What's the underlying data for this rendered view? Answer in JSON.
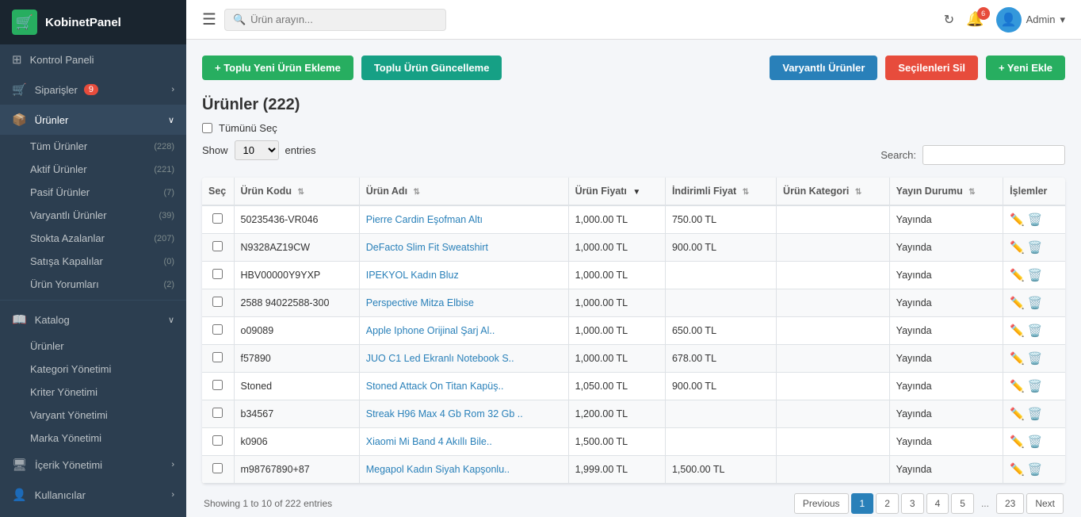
{
  "brand": {
    "name": "KobinetPanel",
    "icon": "🛒"
  },
  "sidebar": {
    "items": [
      {
        "id": "kontrol-paneli",
        "label": "Kontrol Paneli",
        "icon": "⊞",
        "badge": null,
        "hasArrow": false
      },
      {
        "id": "siparisler",
        "label": "Siparişler",
        "icon": "🛒",
        "badge": "9",
        "hasArrow": true
      },
      {
        "id": "urunler",
        "label": "Ürünler",
        "icon": "📦",
        "badge": null,
        "hasArrow": true,
        "active": true
      }
    ],
    "urunler_sub": [
      {
        "id": "tum-urunler",
        "label": "Tüm Ürünler",
        "count": "(228)"
      },
      {
        "id": "aktif-urunler",
        "label": "Aktif Ürünler",
        "count": "(221)"
      },
      {
        "id": "pasif-urunler",
        "label": "Pasif Ürünler",
        "count": "(7)"
      },
      {
        "id": "varyantli-urunler",
        "label": "Varyantlı Ürünler",
        "count": "(39)"
      },
      {
        "id": "stokta-azalanlar",
        "label": "Stokta Azalanlar",
        "count": "(207)"
      },
      {
        "id": "satisa-kapalanlar",
        "label": "Satışa Kapalılar",
        "count": "(0)"
      },
      {
        "id": "urun-yorumlari",
        "label": "Ürün Yorumları",
        "count": "(2)"
      }
    ],
    "katalog": {
      "label": "Katalog",
      "sub": [
        {
          "id": "katalog-urunler",
          "label": "Ürünler"
        },
        {
          "id": "kategori-yonetimi",
          "label": "Kategori Yönetimi"
        },
        {
          "id": "kriter-yonetimi",
          "label": "Kriter Yönetimi"
        },
        {
          "id": "varyant-yonetimi",
          "label": "Varyant Yönetimi"
        },
        {
          "id": "marka-yonetimi",
          "label": "Marka Yönetimi"
        }
      ]
    },
    "icerik": {
      "label": "İçerik Yönetimi",
      "hasArrow": true
    },
    "kullanicilar": {
      "label": "Kullanıcılar",
      "hasArrow": true
    }
  },
  "topbar": {
    "search_placeholder": "Ürün arayın...",
    "bell_count": "6",
    "user_label": "Admin"
  },
  "buttons": {
    "bulk_add": "+ Toplu Yeni Ürün Ekleme",
    "bulk_update": "Toplu Ürün Güncelleme",
    "variant_products": "Varyantlı Ürünler",
    "delete_selected": "Seçilenleri Sil",
    "new_add": "+ Yeni Ekle"
  },
  "page": {
    "title": "Ürünler (222)",
    "select_all": "Tümünü Seç",
    "show_label": "Show",
    "entries_label": "entries",
    "show_count": "10",
    "search_label": "Search:"
  },
  "table": {
    "columns": [
      {
        "id": "sec",
        "label": "Seç",
        "sortable": false
      },
      {
        "id": "urun-kodu",
        "label": "Ürün Kodu",
        "sortable": true
      },
      {
        "id": "urun-adi",
        "label": "Ürün Adı",
        "sortable": true
      },
      {
        "id": "urun-fiyati",
        "label": "Ürün Fiyatı",
        "sortable": true,
        "active": true,
        "dir": "asc"
      },
      {
        "id": "indirimli-fiyat",
        "label": "İndirimli Fiyat",
        "sortable": true
      },
      {
        "id": "urun-kategori",
        "label": "Ürün Kategori",
        "sortable": true
      },
      {
        "id": "yayin-durumu",
        "label": "Yayın Durumu",
        "sortable": true
      },
      {
        "id": "islemler",
        "label": "İşlemler",
        "sortable": false
      }
    ],
    "rows": [
      {
        "id": 1,
        "kod": "50235436-VR046",
        "adi": "Pierre Cardin Eşofman Altı",
        "fiyat": "1,000.00 TL",
        "indirimli": "750.00 TL",
        "kategori": "",
        "durum": "Yayında"
      },
      {
        "id": 2,
        "kod": "N9328AZ19CW",
        "adi": "DeFacto Slim Fit Sweatshirt",
        "fiyat": "1,000.00 TL",
        "indirimli": "900.00 TL",
        "kategori": "",
        "durum": "Yayında"
      },
      {
        "id": 3,
        "kod": "HBV00000Y9YXP",
        "adi": "IPEKYOL Kadın Bluz",
        "fiyat": "1,000.00 TL",
        "indirimli": "",
        "kategori": "",
        "durum": "Yayında"
      },
      {
        "id": 4,
        "kod": "2588 94022588-300",
        "adi": "Perspective Mitza Elbise",
        "fiyat": "1,000.00 TL",
        "indirimli": "",
        "kategori": "",
        "durum": "Yayında"
      },
      {
        "id": 5,
        "kod": "o09089",
        "adi": "Apple Iphone Orijinal Şarj Al..",
        "fiyat": "1,000.00 TL",
        "indirimli": "650.00 TL",
        "kategori": "",
        "durum": "Yayında"
      },
      {
        "id": 6,
        "kod": "f57890",
        "adi": "JUO C1 Led Ekranlı Notebook S..",
        "fiyat": "1,000.00 TL",
        "indirimli": "678.00 TL",
        "kategori": "",
        "durum": "Yayında"
      },
      {
        "id": 7,
        "kod": "Stoned",
        "adi": "Stoned Attack On Titan Kapüş..",
        "fiyat": "1,050.00 TL",
        "indirimli": "900.00 TL",
        "kategori": "",
        "durum": "Yayında"
      },
      {
        "id": 8,
        "kod": "b34567",
        "adi": "Streak H96 Max 4 Gb Rom 32 Gb ..",
        "fiyat": "1,200.00 TL",
        "indirimli": "",
        "kategori": "",
        "durum": "Yayında"
      },
      {
        "id": 9,
        "kod": "k0906",
        "adi": "Xiaomi Mi Band 4 Akıllı Bile..",
        "fiyat": "1,500.00 TL",
        "indirimli": "",
        "kategori": "",
        "durum": "Yayında"
      },
      {
        "id": 10,
        "kod": "m98767890+87",
        "adi": "Megapol Kadın Siyah Kapşonlu..",
        "fiyat": "1,999.00 TL",
        "indirimli": "1,500.00 TL",
        "kategori": "",
        "durum": "Yayında"
      }
    ]
  },
  "pagination": {
    "info": "Showing 1 to 10 of 222 entries",
    "prev_label": "Previous",
    "next_label": "Next",
    "pages": [
      "1",
      "2",
      "3",
      "4",
      "5",
      "...",
      "23"
    ],
    "active_page": "1"
  }
}
